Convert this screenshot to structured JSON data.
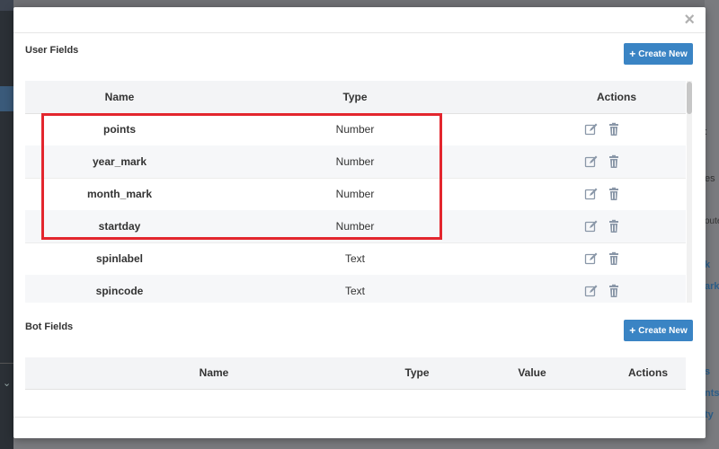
{
  "modal": {
    "close_glyph": "×"
  },
  "user_fields": {
    "title": "User Fields",
    "create_button": "Create New",
    "columns": [
      "Name",
      "Type",
      "Actions"
    ],
    "rows": [
      {
        "name": "points",
        "type": "Number"
      },
      {
        "name": "year_mark",
        "type": "Number"
      },
      {
        "name": "month_mark",
        "type": "Number"
      },
      {
        "name": "startday",
        "type": "Number"
      },
      {
        "name": "spinlabel",
        "type": "Text"
      },
      {
        "name": "spincode",
        "type": "Text"
      }
    ]
  },
  "bot_fields": {
    "title": "Bot Fields",
    "create_button": "Create New",
    "columns": [
      "Name",
      "Type",
      "Value",
      "Actions"
    ]
  },
  "background_fragments": [
    ":",
    "es",
    "oute",
    "k",
    "ark",
    "s",
    "nts",
    "ty"
  ],
  "colors": {
    "accent": "#3a84c4",
    "highlight": "#e3262e",
    "icon": "#8a97a8"
  }
}
